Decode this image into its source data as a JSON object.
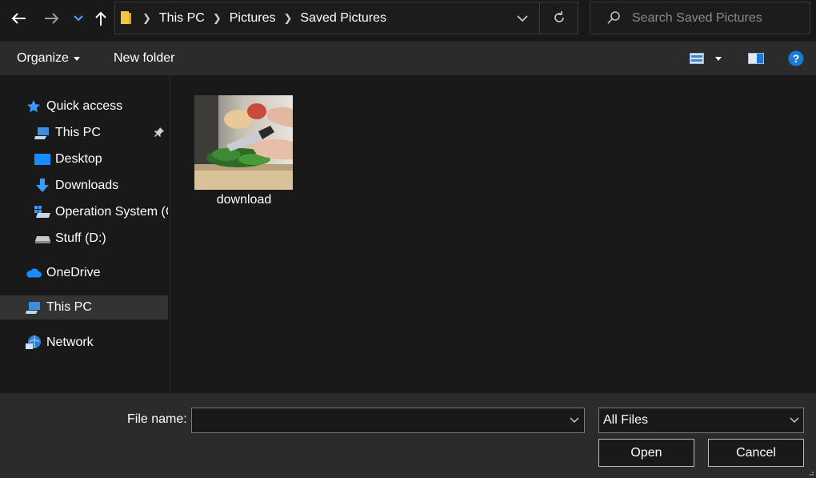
{
  "navigation": {
    "back_icon": "back-arrow-icon",
    "forward_icon": "forward-arrow-icon",
    "recent_icon": "chevron-down-icon",
    "up_icon": "up-arrow-icon"
  },
  "address": {
    "crumbs": [
      "This PC",
      "Pictures",
      "Saved Pictures"
    ]
  },
  "search": {
    "placeholder": "Search Saved Pictures"
  },
  "toolbar": {
    "organize_label": "Organize",
    "new_folder_label": "New folder"
  },
  "sidebar": {
    "items": [
      {
        "label": "Quick access",
        "icon": "star-icon"
      },
      {
        "label": "This PC",
        "icon": "computer-icon"
      },
      {
        "label": "Desktop",
        "icon": "desktop-icon"
      },
      {
        "label": "Downloads",
        "icon": "download-arrow-icon"
      },
      {
        "label": "Operation System (C:)",
        "icon": "windows-drive-icon"
      },
      {
        "label": "Stuff (D:)",
        "icon": "drive-icon"
      },
      {
        "label": "OneDrive",
        "icon": "cloud-icon"
      },
      {
        "label": "This PC",
        "icon": "computer-icon"
      },
      {
        "label": "Network",
        "icon": "network-icon"
      }
    ]
  },
  "files": [
    {
      "name": "download",
      "type": "image"
    }
  ],
  "footer": {
    "file_name_label": "File name:",
    "file_name_value": "",
    "filter_value": "All Files",
    "open_label": "Open",
    "cancel_label": "Cancel"
  },
  "colors": {
    "background": "#191919",
    "toolbar": "#2b2b2b",
    "selected": "#333333",
    "accent_blue": "#1a7ad8",
    "folder_yellow": "#f4c542"
  }
}
